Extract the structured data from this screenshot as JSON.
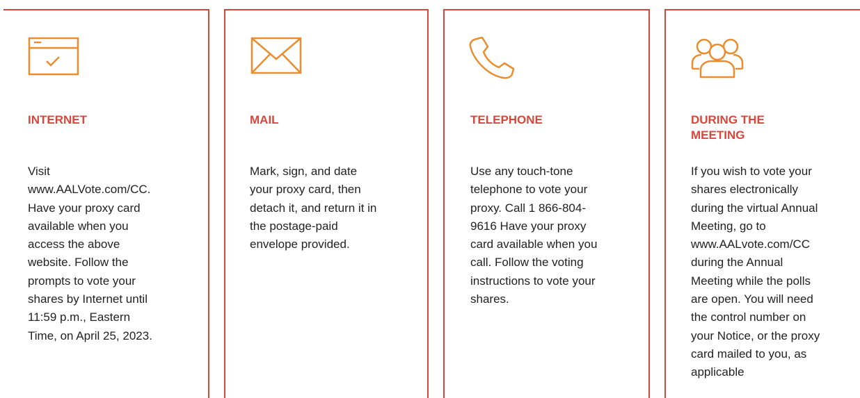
{
  "colors": {
    "accent_red": "#d9463b",
    "icon_orange": "#ec8c2c",
    "body_text": "#222222"
  },
  "cards": [
    {
      "icon": "browser-checkmark-icon",
      "title": "INTERNET",
      "body": "Visit\nwww.AALVote.com/CC.\nHave your proxy card\navailable when you\naccess the above\nwebsite. Follow the\nprompts to vote your\nshares by Internet until\n11:59 p.m., Eastern\nTime, on April 25, 2023."
    },
    {
      "icon": "envelope-icon",
      "title": "MAIL",
      "body": "Mark, sign, and date\nyour proxy card, then\ndetach it, and return it in\nthe postage-paid\nenvelope provided."
    },
    {
      "icon": "telephone-icon",
      "title": "TELEPHONE",
      "body": "Use any touch-tone\ntelephone to vote your\nproxy. Call 1 866-804-\n9616 Have your proxy\ncard available when you\ncall. Follow the voting\ninstructions to vote your\nshares."
    },
    {
      "icon": "people-group-icon",
      "title": "DURING THE\nMEETING",
      "body": "If you wish to vote your\nshares electronically\nduring the virtual Annual\nMeeting, go to\nwww.AALvote.com/CC\nduring the Annual\nMeeting while the polls\nare open. You will need\nthe control number on\nyour Notice, or the proxy\ncard mailed to you, as\napplicable"
    }
  ]
}
